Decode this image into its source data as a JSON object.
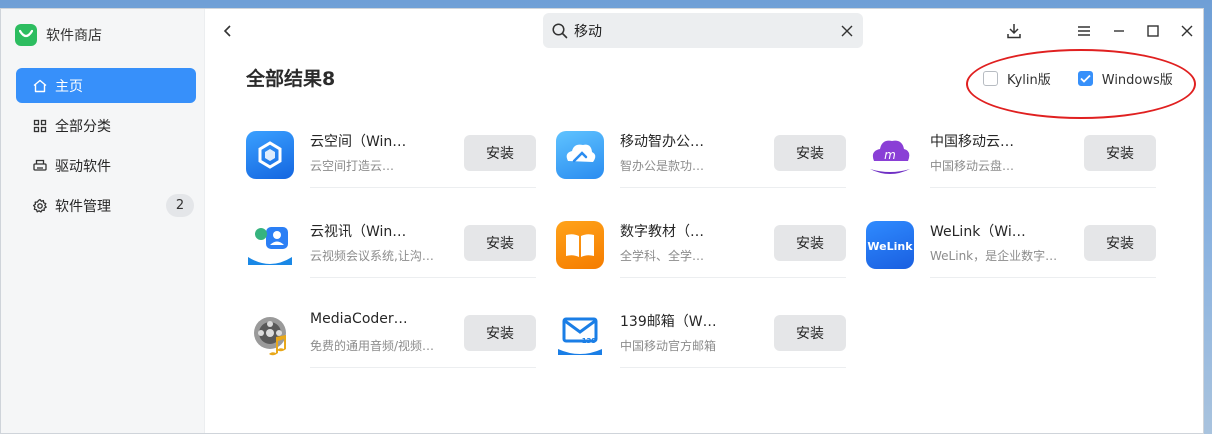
{
  "app": {
    "title": "软件商店"
  },
  "sidebar": {
    "items": [
      {
        "label": "主页",
        "icon": "home-icon",
        "active": true
      },
      {
        "label": "全部分类",
        "icon": "grid-icon"
      },
      {
        "label": "驱动软件",
        "icon": "printer-icon"
      },
      {
        "label": "软件管理",
        "icon": "gear-icon",
        "badge": "2"
      }
    ]
  },
  "search": {
    "value": "移动"
  },
  "results": {
    "title": "全部结果8"
  },
  "filters": [
    {
      "label": "Kylin版",
      "checked": false
    },
    {
      "label": "Windows版",
      "checked": true
    }
  ],
  "apps": [
    {
      "name": "云空间（Win…",
      "desc": "云空间打造云…",
      "install": "安装",
      "icon": "cloud-space-icon"
    },
    {
      "name": "移动智办公…",
      "desc": "智办公是款功…",
      "install": "安装",
      "icon": "smart-office-icon"
    },
    {
      "name": "中国移动云…",
      "desc": "中国移动云盘…",
      "install": "安装",
      "icon": "china-mobile-cloud-icon"
    },
    {
      "name": "云视讯（Win…",
      "desc": "云视频会议系统,让沟…",
      "install": "安装",
      "icon": "cloud-video-icon"
    },
    {
      "name": "数字教材（…",
      "desc": "全学科、全学…",
      "install": "安装",
      "icon": "digital-textbook-icon"
    },
    {
      "name": "WeLink（Wi…",
      "desc": "WeLink，是企业数字…",
      "install": "安装",
      "icon": "welink-icon",
      "icon_text": "WeLink"
    },
    {
      "name": "MediaCoder…",
      "desc": "免费的通用音频/视频…",
      "install": "安装",
      "icon": "mediacoder-icon"
    },
    {
      "name": "139邮箱（W…",
      "desc": "中国移动官方邮箱",
      "install": "安装",
      "icon": "mail-139-icon",
      "icon_text": "139"
    }
  ],
  "colors": {
    "accent": "#3790fa",
    "highlight": "#e02020"
  }
}
